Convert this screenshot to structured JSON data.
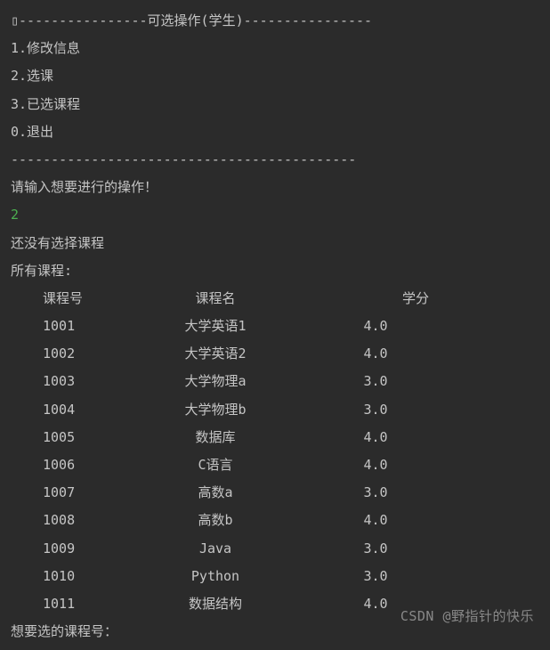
{
  "header": {
    "prefix": "▯",
    "dashL": "----------------",
    "title": "可选操作(学生)",
    "dashR": "----------------"
  },
  "menu": {
    "items": [
      {
        "idx": "1",
        "label": "修改信息"
      },
      {
        "idx": "2",
        "label": "选课"
      },
      {
        "idx": "3",
        "label": "已选课程"
      },
      {
        "idx": "0",
        "label": "退出"
      }
    ]
  },
  "divider": "-------------------------------------------",
  "prompt_action": "请输入想要进行的操作！",
  "user_input": "2",
  "no_selection_msg": "还没有选择课程",
  "all_courses_label": "所有课程:",
  "table": {
    "headers": {
      "id": "课程号",
      "name": "课程名",
      "credit": "学分"
    },
    "rows": [
      {
        "id": "1001",
        "name": "大学英语1",
        "credit": "4.0"
      },
      {
        "id": "1002",
        "name": "大学英语2",
        "credit": "4.0"
      },
      {
        "id": "1003",
        "name": "大学物理a",
        "credit": "3.0"
      },
      {
        "id": "1004",
        "name": "大学物理b",
        "credit": "3.0"
      },
      {
        "id": "1005",
        "name": "数据库",
        "credit": "4.0"
      },
      {
        "id": "1006",
        "name": "C语言",
        "credit": "4.0"
      },
      {
        "id": "1007",
        "name": "高数a",
        "credit": "3.0"
      },
      {
        "id": "1008",
        "name": "高数b",
        "credit": "4.0"
      },
      {
        "id": "1009",
        "name": "Java",
        "credit": "3.0"
      },
      {
        "id": "1010",
        "name": "Python",
        "credit": "3.0"
      },
      {
        "id": "1011",
        "name": "数据结构",
        "credit": "4.0"
      }
    ]
  },
  "prompt_course": "想要选的课程号：",
  "watermark": "CSDN @野指针的快乐"
}
